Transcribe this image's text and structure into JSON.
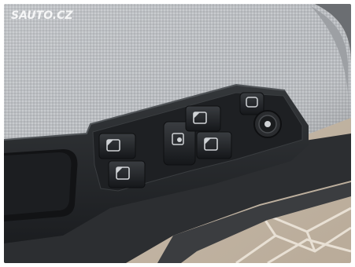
{
  "photo": {
    "watermark": "SAUTO.CZ",
    "switches": [
      {
        "name": "front-left-window",
        "icon": "window-icon"
      },
      {
        "name": "rear-left-window",
        "icon": "window-icon"
      },
      {
        "name": "front-right-window",
        "icon": "window-icon"
      },
      {
        "name": "rear-right-window",
        "icon": "window-icon"
      },
      {
        "name": "child-lock",
        "icon": "child-lock-icon"
      },
      {
        "name": "mirror-adjust",
        "icon": "mirror-icon"
      },
      {
        "name": "mirror-selector",
        "icon": "mirror-knob-icon"
      }
    ],
    "colors": {
      "fabric": "#b9bcc0",
      "plastic": "#222427",
      "floor": "#d2c6b6"
    }
  }
}
